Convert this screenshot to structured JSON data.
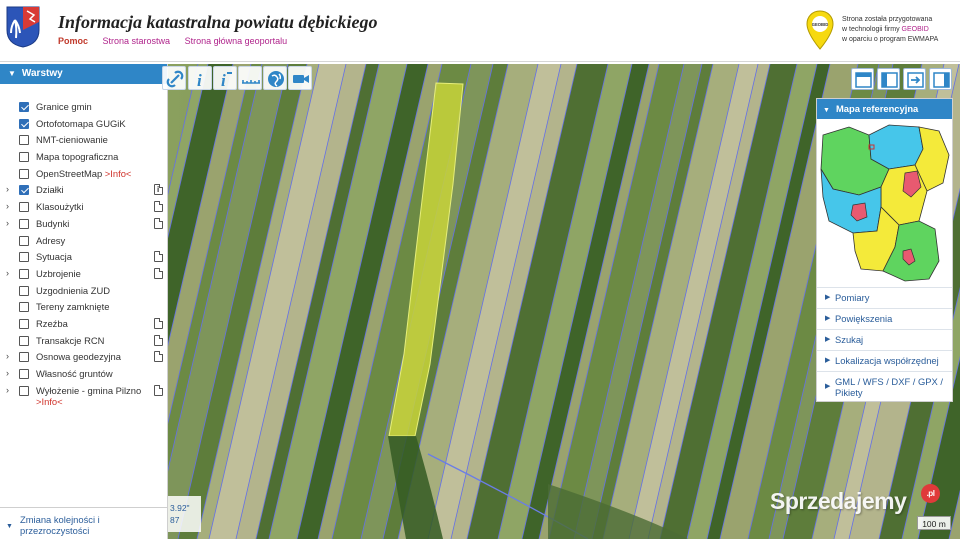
{
  "header": {
    "title": "Informacja katastralna powiatu dębickiego",
    "nav": [
      "Pomoc",
      "Strona starostwa",
      "Strona główna geoportalu"
    ],
    "geobid_lines": [
      "Strona została przygotowana",
      "w technologii firmy ",
      "GEOBID",
      "w oparciu o program EWMAPA"
    ],
    "logo_text": "GEOBID"
  },
  "left_panel": {
    "title": "Warstwy",
    "layers": [
      {
        "label": "Granice gmin",
        "checked": true,
        "expandable": false,
        "doc": false
      },
      {
        "label": "Ortofotomapa GUGiK",
        "checked": true,
        "expandable": false,
        "doc": false
      },
      {
        "label": "NMT-cieniowanie",
        "checked": false,
        "expandable": false,
        "doc": false
      },
      {
        "label": "Mapa topograficzna",
        "checked": false,
        "expandable": false,
        "doc": false
      },
      {
        "label": "OpenStreetMap ",
        "info": ">Info<",
        "checked": false,
        "expandable": false,
        "doc": false
      },
      {
        "label": "Działki",
        "checked": true,
        "expandable": true,
        "doc": "info"
      },
      {
        "label": "Klasoużytki",
        "checked": false,
        "expandable": true,
        "doc": true
      },
      {
        "label": "Budynki",
        "checked": false,
        "expandable": true,
        "doc": true
      },
      {
        "label": "Adresy",
        "checked": false,
        "expandable": false,
        "doc": false
      },
      {
        "label": "Sytuacja",
        "checked": false,
        "expandable": false,
        "doc": true
      },
      {
        "label": "Uzbrojenie",
        "checked": false,
        "expandable": true,
        "doc": true
      },
      {
        "label": "Uzgodnienia ZUD",
        "checked": false,
        "expandable": false,
        "doc": false
      },
      {
        "label": "Tereny zamknięte",
        "checked": false,
        "expandable": false,
        "doc": false
      },
      {
        "label": "Rzeźba",
        "checked": false,
        "expandable": false,
        "doc": true
      },
      {
        "label": "Transakcje RCN",
        "checked": false,
        "expandable": false,
        "doc": true
      },
      {
        "label": "Osnowa geodezyjna",
        "checked": false,
        "expandable": true,
        "doc": true
      },
      {
        "label": "Własność gruntów",
        "checked": false,
        "expandable": true,
        "doc": false
      },
      {
        "label": "Wyłożenie - gmina Pilzno",
        "info": ">Info<",
        "checked": false,
        "expandable": true,
        "doc": true,
        "tall": true
      }
    ],
    "footer": "Zmiana kolejności i przezroczystości"
  },
  "right_panel": {
    "title": "Mapa referencyjna",
    "items": [
      "Pomiary",
      "Powiększenia",
      "Szukaj",
      "Lokalizacja współrzędnej",
      "GML / WFS / DXF / GPX / Pikiety"
    ]
  },
  "map": {
    "coords_line1": "3.92\"",
    "coords_line2": "87",
    "scale": "100 m",
    "watermark": "Sprzedajemy",
    "watermark_badge": ".pl"
  },
  "colors": {
    "accent": "#2f86c7",
    "link": "#2a5d9a",
    "nav": "#b0258c",
    "highlight_parcel": "#c8d43a"
  }
}
